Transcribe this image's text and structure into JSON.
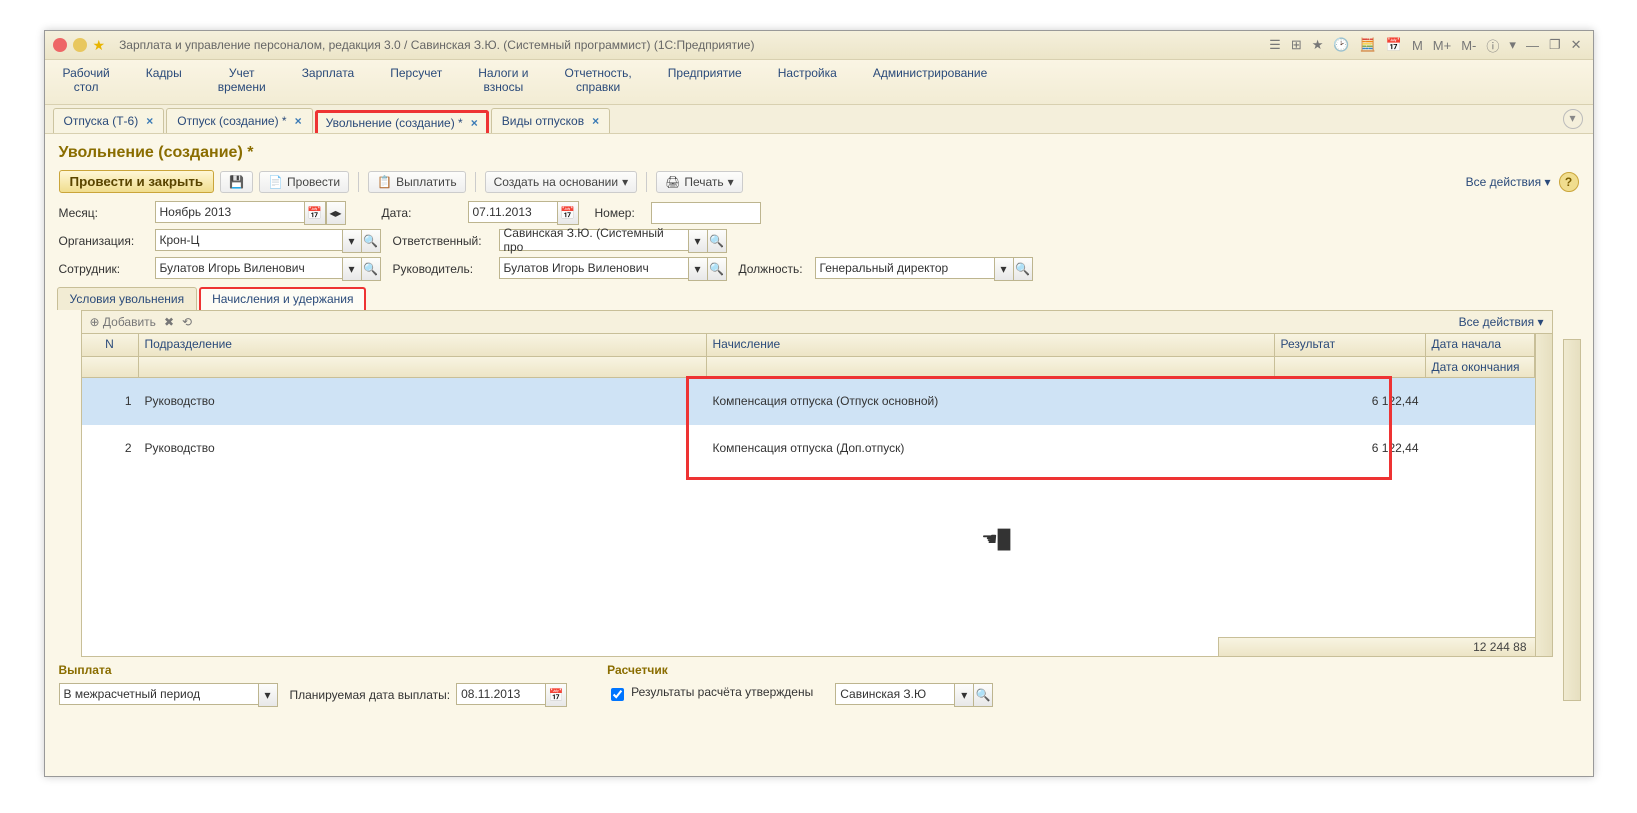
{
  "titlebar": {
    "title": "Зарплата и управление персоналом, редакция 3.0 / Савинская З.Ю. (Системный программист)  (1С:Предприятие)",
    "m_buttons": [
      "M",
      "M+",
      "M-"
    ]
  },
  "mainmenu": [
    "Рабочий\nстол",
    "Кадры",
    "Учет\nвремени",
    "Зарплата",
    "Персучет",
    "Налоги и\nвзносы",
    "Отчетность,\nсправки",
    "Предприятие",
    "Настройка",
    "Администрирование"
  ],
  "doctabs": [
    {
      "label": "Отпуска (Т-6)"
    },
    {
      "label": "Отпуск (создание) *"
    },
    {
      "label": "Увольнение (создание) *",
      "highlight": true
    },
    {
      "label": "Виды отпусков"
    }
  ],
  "page_title": "Увольнение (создание) *",
  "toolbar": {
    "post_close": "Провести и закрыть",
    "post": "Провести",
    "pay": "Выплатить",
    "create_based": "Создать на основании",
    "print": "Печать",
    "all_actions": "Все действия"
  },
  "form": {
    "month_lbl": "Месяц:",
    "month_val": "Ноябрь 2013",
    "date_lbl": "Дата:",
    "date_val": "07.11.2013",
    "number_lbl": "Номер:",
    "number_val": "",
    "org_lbl": "Организация:",
    "org_val": "Крон-Ц",
    "resp_lbl": "Ответственный:",
    "resp_val": "Савинская З.Ю. (Системный про",
    "emp_lbl": "Сотрудник:",
    "emp_val": "Булатов Игорь Виленович",
    "mgr_lbl": "Руководитель:",
    "mgr_val": "Булатов Игорь Виленович",
    "pos_lbl": "Должность:",
    "pos_val": "Генеральный директор"
  },
  "innertabs": {
    "cond": "Условия увольнения",
    "accr": "Начисления и удержания"
  },
  "gridtoolbar": {
    "add": "Добавить",
    "all": "Все действия"
  },
  "grid": {
    "head": {
      "n": "N",
      "dep": "Подразделение",
      "acc": "Начисление",
      "res": "Результат",
      "d1": "Дата начала",
      "d2": "Дата окончания"
    },
    "rows": [
      {
        "n": "1",
        "dep": "Руководство",
        "acc": "Компенсация отпуска (Отпуск основной)",
        "res": "6 122,44"
      },
      {
        "n": "2",
        "dep": "Руководство",
        "acc": "Компенсация отпуска (Доп.отпуск)",
        "res": "6 122,44"
      }
    ],
    "sum": "12 244 88"
  },
  "footer": {
    "payout_hdr": "Выплата",
    "payout_val": "В межрасчетный период",
    "plan_lbl": "Планируемая дата выплаты:",
    "plan_val": "08.11.2013",
    "calc_hdr": "Расчетчик",
    "approved": "Результаты расчёта утверждены",
    "calc_val": "Савинская З.Ю"
  }
}
